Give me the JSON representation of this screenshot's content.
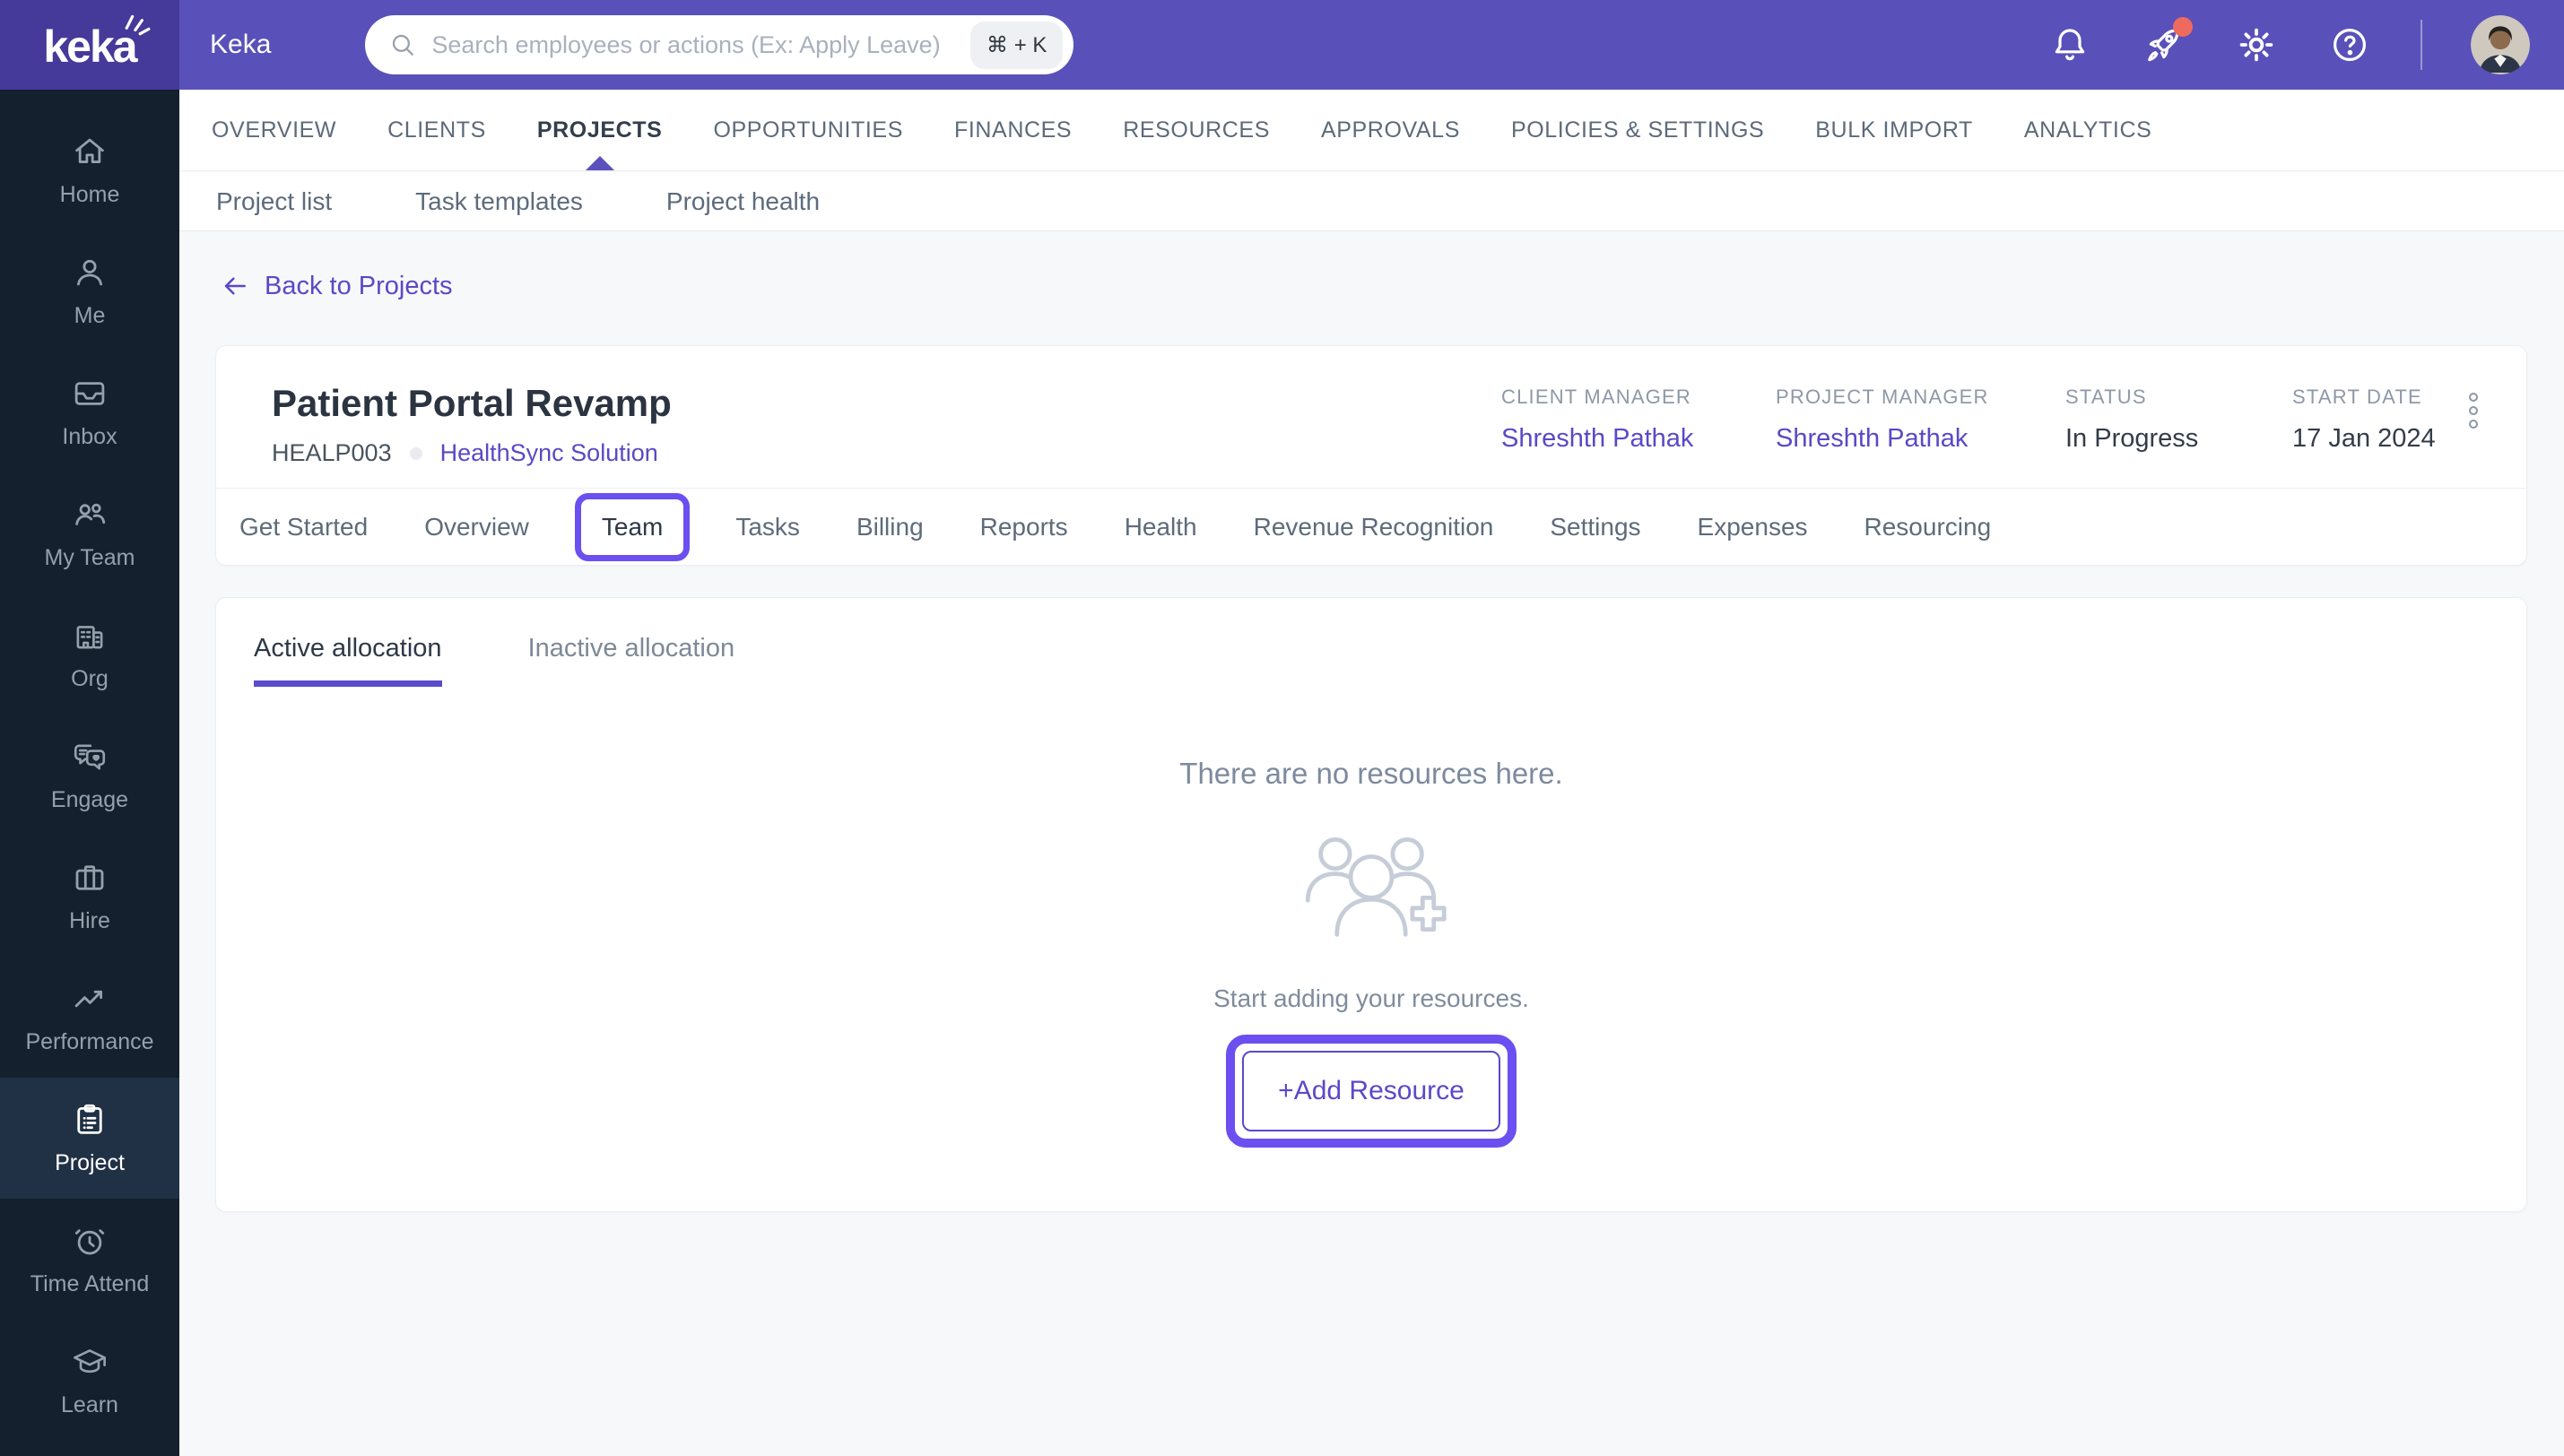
{
  "topbar": {
    "brand": "keka",
    "app_title": "Keka",
    "search_placeholder": "Search employees or actions (Ex: Apply Leave)",
    "search_shortcut": "⌘ + K",
    "icons": [
      "bell-icon",
      "rocket-icon",
      "gear-icon",
      "help-icon"
    ]
  },
  "main_nav": {
    "active": "PROJECTS",
    "items": [
      "OVERVIEW",
      "CLIENTS",
      "PROJECTS",
      "OPPORTUNITIES",
      "FINANCES",
      "RESOURCES",
      "APPROVALS",
      "POLICIES & SETTINGS",
      "BULK IMPORT",
      "ANALYTICS"
    ]
  },
  "sub_nav": {
    "items": [
      "Project list",
      "Task templates",
      "Project health"
    ]
  },
  "back_link": "Back to Projects",
  "project": {
    "title": "Patient Portal Revamp",
    "code": "HEALP003",
    "client_name": "HealthSync Solution",
    "meta": [
      {
        "label": "CLIENT MANAGER",
        "value": "Shreshth Pathak"
      },
      {
        "label": "PROJECT MANAGER",
        "value": "Shreshth Pathak"
      },
      {
        "label": "STATUS",
        "value": "In Progress"
      },
      {
        "label": "START DATE",
        "value": "17 Jan 2024"
      }
    ],
    "tabs": [
      "Get Started",
      "Overview",
      "Team",
      "Tasks",
      "Billing",
      "Reports",
      "Health",
      "Revenue Recognition",
      "Settings",
      "Expenses",
      "Resourcing"
    ],
    "active_tab": "Team"
  },
  "allocation": {
    "tabs": [
      "Active allocation",
      "Inactive allocation"
    ],
    "active": "Active allocation"
  },
  "empty_state": {
    "title": "There are no resources here.",
    "subtitle": "Start adding your resources.",
    "button_label": "+Add Resource",
    "illustration": "people-group-plus-icon"
  },
  "sidebar": {
    "active": "Project",
    "items": [
      {
        "label": "Home",
        "icon": "home-icon"
      },
      {
        "label": "Me",
        "icon": "user-icon"
      },
      {
        "label": "Inbox",
        "icon": "inbox-icon"
      },
      {
        "label": "My Team",
        "icon": "team-icon"
      },
      {
        "label": "Org",
        "icon": "building-icon"
      },
      {
        "label": "Engage",
        "icon": "engage-chat-icon"
      },
      {
        "label": "Hire",
        "icon": "briefcase-icon"
      },
      {
        "label": "Performance",
        "icon": "trend-icon"
      },
      {
        "label": "Project",
        "icon": "clipboard-icon"
      },
      {
        "label": "Time Attend",
        "icon": "alarm-clock-icon"
      },
      {
        "label": "Learn",
        "icon": "graduation-cap-icon"
      }
    ]
  },
  "colors": {
    "header_purple": "#5A50B9",
    "logo_purple": "#453A9A",
    "accent_highlight": "#6C4FF0",
    "link_purple": "#5949C6",
    "active_underline": "#5B4CCC",
    "sidebar_bg": "#14202E",
    "sidebar_active_bg": "#203145",
    "page_bg": "#F7F8FA",
    "notification_red": "#EE6A5F"
  }
}
